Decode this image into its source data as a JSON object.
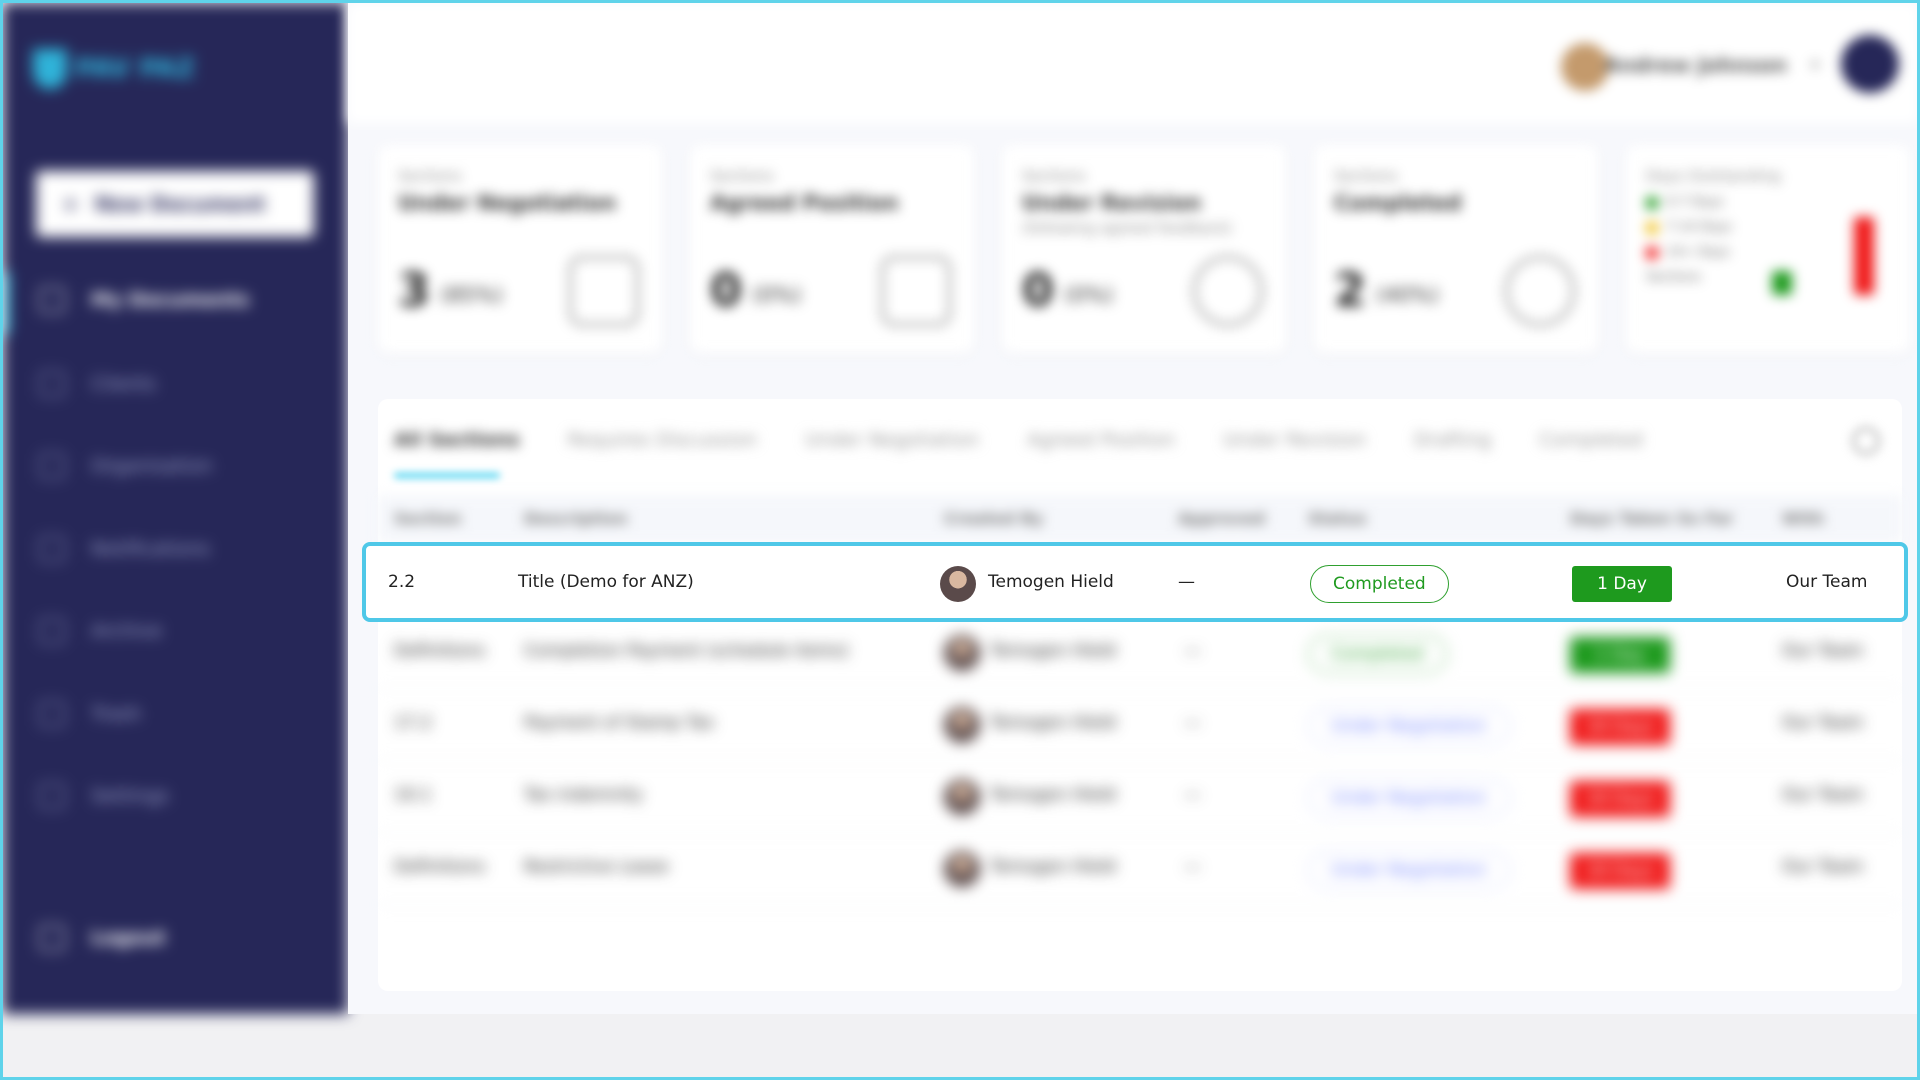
{
  "brand": {
    "name": "PAV PAZ"
  },
  "sidebar": {
    "new_document": "New Document",
    "items": [
      {
        "label": "My Documents"
      },
      {
        "label": "Clients"
      },
      {
        "label": "Organisation"
      },
      {
        "label": "Notifications"
      },
      {
        "label": "Archive"
      },
      {
        "label": "Trash"
      },
      {
        "label": "Settings"
      }
    ],
    "logout": "Logout"
  },
  "header": {
    "user_name": "Andrew Johnson"
  },
  "cards": [
    {
      "small": "Sections",
      "title": "Under Negotiation",
      "sub": "",
      "count": "3",
      "unit": "(85%)"
    },
    {
      "small": "Sections",
      "title": "Agreed Position",
      "sub": "",
      "count": "0",
      "unit": "(0%)"
    },
    {
      "small": "Sections",
      "title": "Under Revision",
      "sub": "(following agreed feedback)",
      "count": "0",
      "unit": "(0%)"
    },
    {
      "small": "Sections",
      "title": "Completed",
      "sub": "",
      "count": "2",
      "unit": "(40%)"
    }
  ],
  "outstanding": {
    "title": "Days Outstanding",
    "legend": [
      "0-7 Days",
      "7-14 Days",
      "14+ Days"
    ],
    "axis_label": "Sections",
    "colors": [
      "#1e9a1e",
      "#f0c020",
      "#f01818"
    ]
  },
  "tabs": [
    "All Sections",
    "Requires Discussion",
    "Under Negotiation",
    "Agreed Position",
    "Under Revision",
    "Drafting",
    "Completed"
  ],
  "table": {
    "headers": [
      "Section",
      "Description",
      "Created By",
      "Approved",
      "Status",
      "Days Taken So Far",
      "With"
    ],
    "rows": [
      {
        "section": "2.2",
        "description": "Title (Demo for ANZ)",
        "created_by": "Temogen Hield",
        "approved": "—",
        "status": "Completed",
        "status_kind": "completed",
        "days": "1 Day",
        "days_color": "#1e9a1e",
        "with": "Our Team"
      },
      {
        "section": "Definitions",
        "description": "Completion Payment (schedule items)",
        "created_by": "Temogen Hield",
        "approved": "—",
        "status": "Completed",
        "status_kind": "completed",
        "days": "1 Day",
        "days_color": "#1e9a1e",
        "with": "Our Team"
      },
      {
        "section": "17.2",
        "description": "Payment of Stamp Tax",
        "created_by": "Temogen Hield",
        "approved": "—",
        "status": "Under Negotiation",
        "status_kind": "negotiation",
        "days": "18 Days",
        "days_color": "#f01818",
        "with": "Our Team"
      },
      {
        "section": "10.1",
        "description": "Tax indemnity",
        "created_by": "Temogen Hield",
        "approved": "—",
        "status": "Under Negotiation",
        "status_kind": "negotiation",
        "days": "18 Days",
        "days_color": "#f01818",
        "with": "Our Team"
      },
      {
        "section": "Definitions",
        "description": "Restrictive Lease",
        "created_by": "Temogen Hield",
        "approved": "—",
        "status": "Under Negotiation",
        "status_kind": "negotiation",
        "days": "18 Days",
        "days_color": "#f01818",
        "with": "Our Team"
      }
    ]
  }
}
